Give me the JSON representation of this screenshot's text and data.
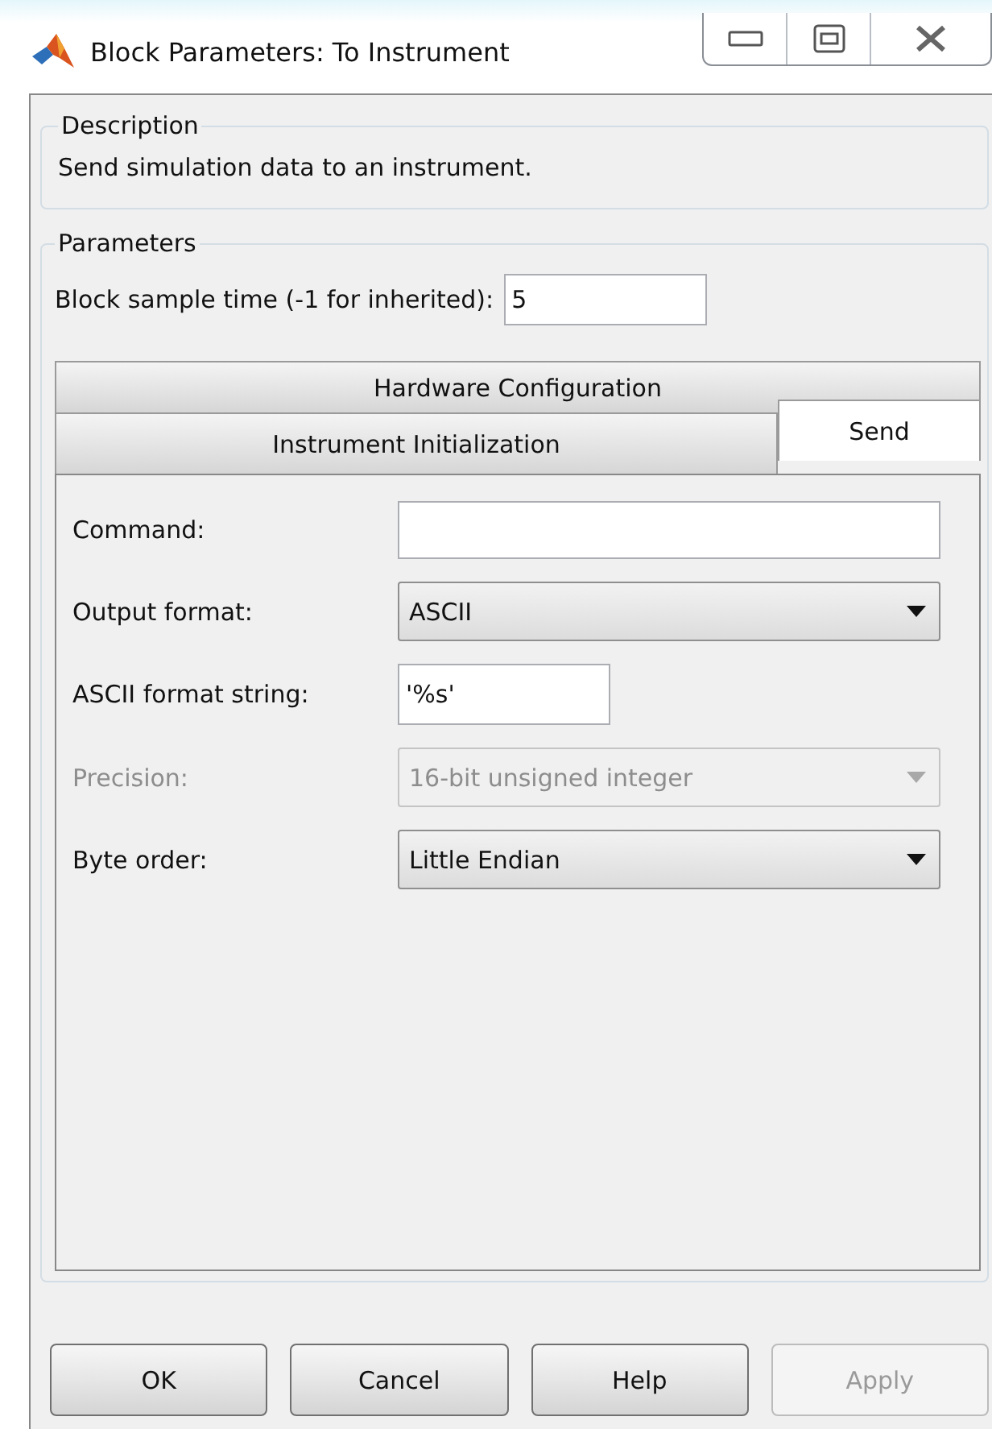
{
  "window": {
    "title": "Block Parameters: To Instrument"
  },
  "description": {
    "heading": "Description",
    "text": "Send simulation data to an instrument."
  },
  "parameters": {
    "heading": "Parameters",
    "sample_time": {
      "label": "Block sample time (-1 for inherited):",
      "value": "5"
    },
    "tab_rows": [
      [
        {
          "label": "Hardware Configuration",
          "selected": false
        }
      ],
      [
        {
          "label": "Instrument Initialization",
          "selected": false
        },
        {
          "label": "Send",
          "selected": true
        }
      ]
    ],
    "fields": [
      {
        "kind": "text",
        "label": "Command:",
        "disabled": false,
        "wide": true
      },
      {
        "kind": "dropdown",
        "label": "Output format:",
        "value": "ASCII",
        "disabled": false
      },
      {
        "kind": "text",
        "label": "ASCII format string:",
        "value": "'%s'",
        "disabled": false,
        "wide": false
      },
      {
        "kind": "dropdown",
        "label": "Precision:",
        "value": "16-bit unsigned integer",
        "disabled": true
      },
      {
        "kind": "dropdown",
        "label": "Byte order:",
        "value": "Little Endian",
        "disabled": false
      }
    ]
  },
  "buttons": [
    {
      "label": "OK",
      "disabled": false
    },
    {
      "label": "Cancel",
      "disabled": false
    },
    {
      "label": "Help",
      "disabled": false
    },
    {
      "label": "Apply",
      "disabled": true
    }
  ]
}
